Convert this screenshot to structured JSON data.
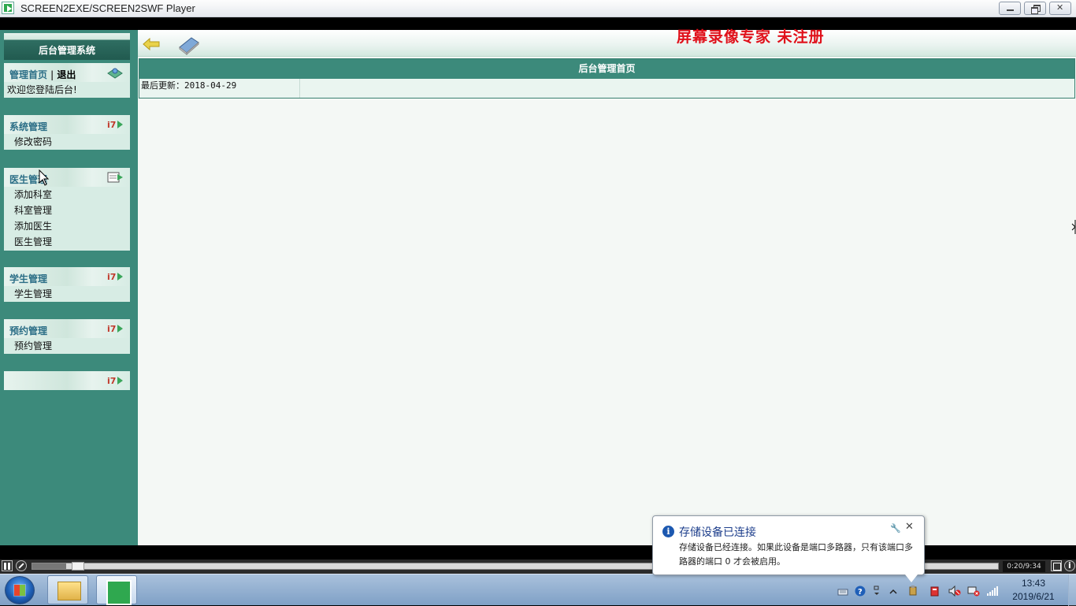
{
  "window": {
    "title": "SCREEN2EXE/SCREEN2SWF Player"
  },
  "toolbar": {
    "watermark": "屏幕录像专家  未注册"
  },
  "sidebar": {
    "system_title": "后台管理系统",
    "home": {
      "home_link": "管理首页",
      "separator": "|",
      "logout": "退出",
      "welcome": "欢迎您登陆后台!"
    },
    "panels": [
      {
        "title": "系统管理",
        "items": [
          "修改密码"
        ]
      },
      {
        "title": "医生管理",
        "items": [
          "添加科室",
          "科室管理",
          "添加医生",
          "医生管理"
        ]
      },
      {
        "title": "学生管理",
        "items": [
          "学生管理"
        ]
      },
      {
        "title": "预约管理",
        "items": [
          "预约管理"
        ]
      },
      {
        "title": "",
        "items": []
      }
    ]
  },
  "main": {
    "table_header": "后台管理首页",
    "last_update": "最后更新：2018-04-29"
  },
  "player": {
    "time": "0:20/9:34",
    "progress": 0.035
  },
  "notification": {
    "title": "存储设备已连接",
    "body": "存储设备已经连接。如果此设备是端口多路器，只有该端口多路器的端口 0 才会被启用。"
  },
  "taskbar": {
    "time": "13:43",
    "date": "2019/6/21"
  },
  "colors": {
    "sidebar_bg": "#3c8a7b",
    "watermark": "#e0101a",
    "header_bg": "#3c8a7b"
  }
}
